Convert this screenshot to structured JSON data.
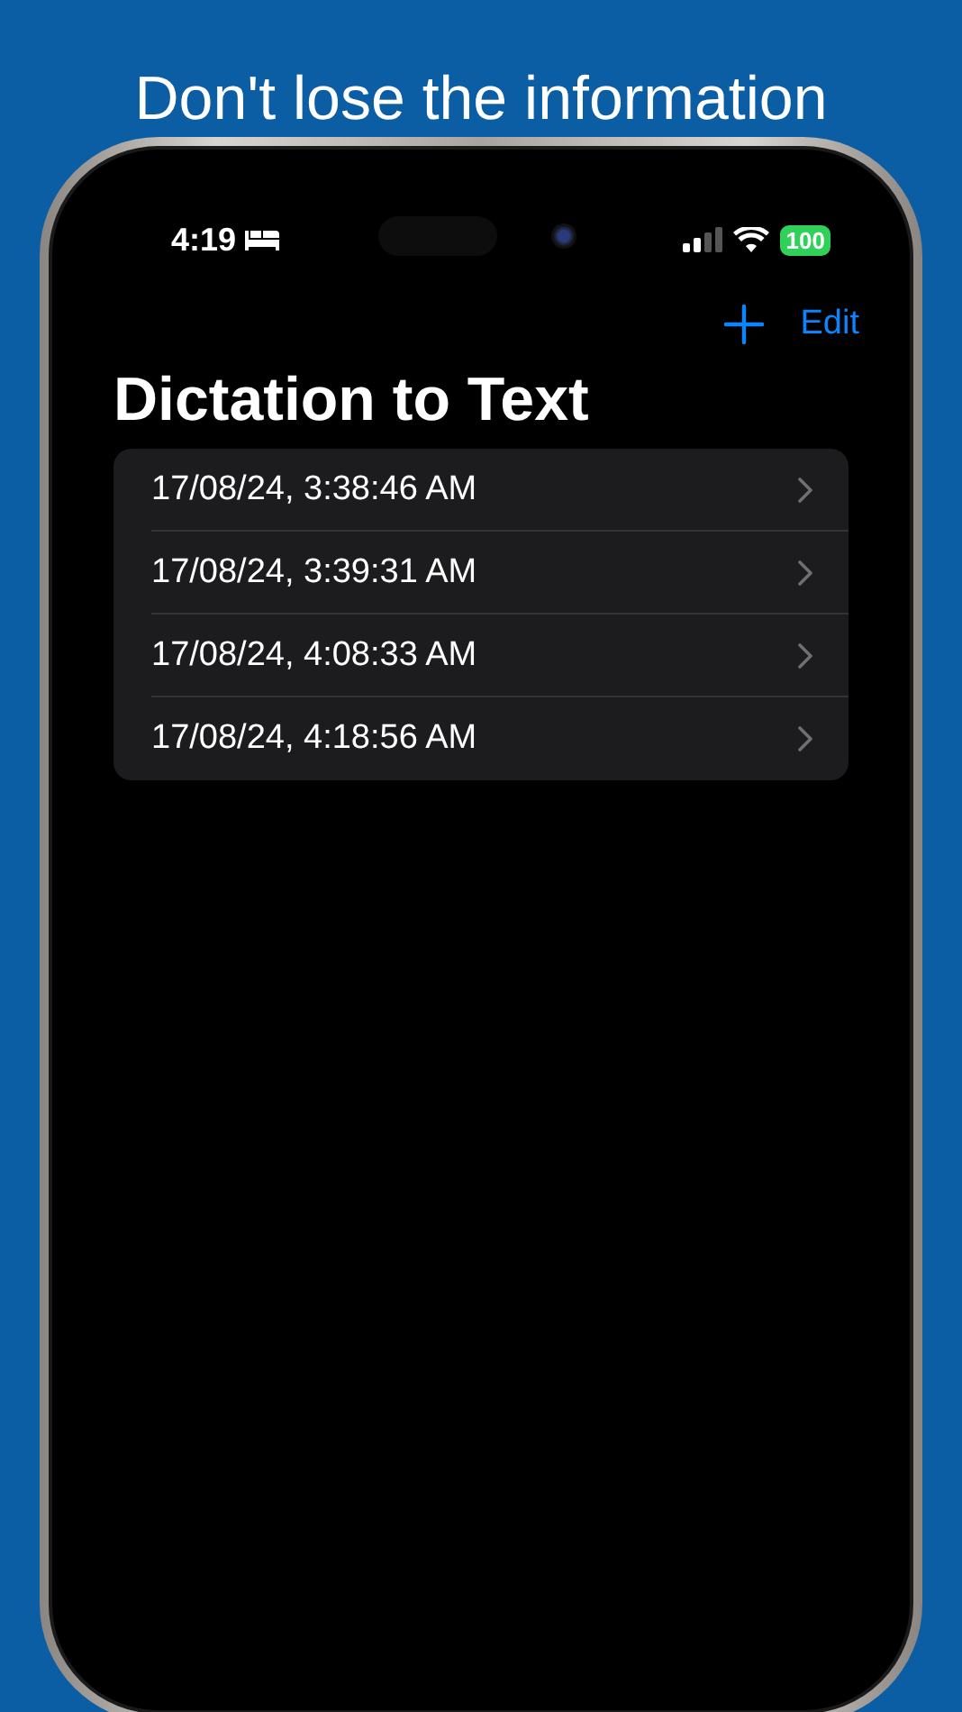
{
  "headline": "Don't lose the information",
  "status_bar": {
    "time": "4:19",
    "battery": "100"
  },
  "nav": {
    "edit": "Edit"
  },
  "title": "Dictation to Text",
  "recordings": [
    {
      "label": "17/08/24, 3:38:46 AM"
    },
    {
      "label": "17/08/24, 3:39:31 AM"
    },
    {
      "label": "17/08/24, 4:08:33 AM"
    },
    {
      "label": "17/08/24, 4:18:56 AM"
    }
  ]
}
